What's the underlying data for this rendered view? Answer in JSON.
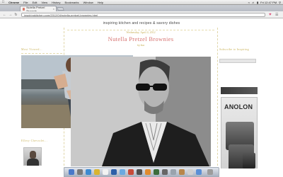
{
  "menubar": {
    "app_name": "Chrome",
    "items": [
      "File",
      "Edit",
      "View",
      "History",
      "Bookmarks",
      "Window",
      "Help"
    ],
    "status": [
      "Fri 12:47 PM"
    ]
  },
  "tab": {
    "title": "Nutella Pretzel Brownie"
  },
  "address_bar": {
    "url": "inspiringkitchen.com/2012/04/nutella-pretzel-brownies.html"
  },
  "page": {
    "blog_title": "inspiring kitchen and recipes & savory dishes",
    "post_date": "Wednesday, April 4, 2012",
    "post_title": "Nutella Pretzel Brownies",
    "byline": "by lisa",
    "left_heading": "Most Viewed...",
    "left_heading_2": "Ellery Chevrolet...",
    "right_heading": "Subscribe to Inspiring",
    "ad_brand": "ANOLON"
  },
  "colors": {
    "accent_gold": "#c9b25a",
    "title_pink": "#d6716f"
  }
}
